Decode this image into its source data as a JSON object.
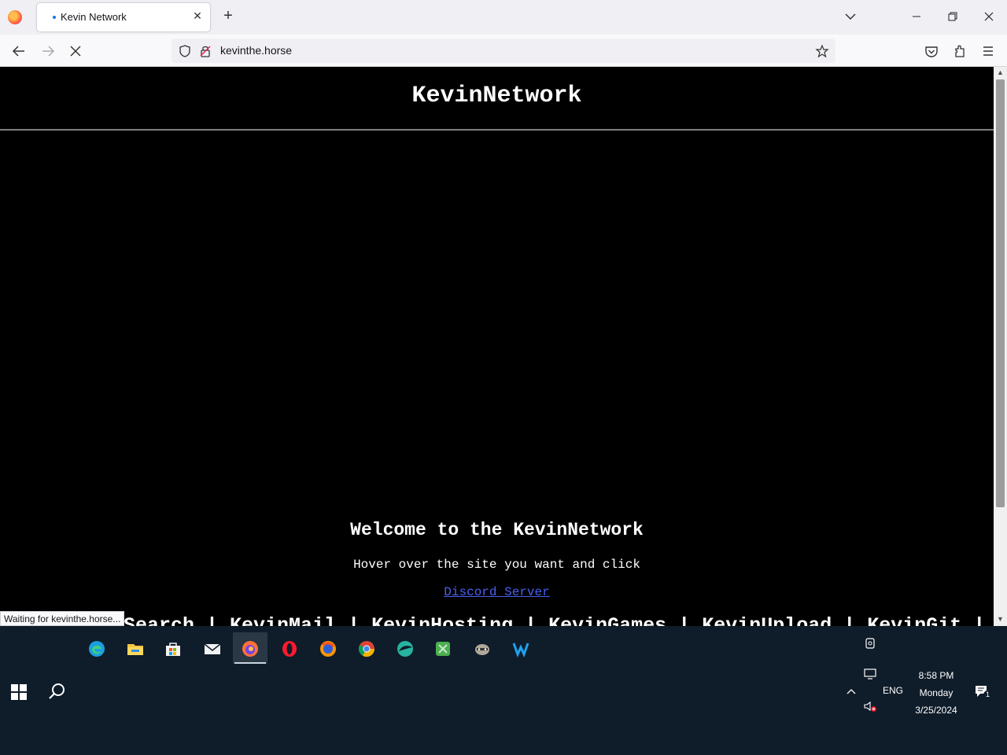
{
  "browser": {
    "tab_title": "Kevin Network",
    "url": "kevinthe.horse",
    "status_text": "Waiting for kevinthe.horse..."
  },
  "page": {
    "site_title": "KevinNetwork",
    "welcome_heading": "Welcome to the KevinNetwork",
    "instruction": "Hover over the site you want and click",
    "discord_link": "Discord Server",
    "links": [
      "Search",
      "|",
      "KevinMail",
      "|",
      "KevinHosting",
      "|",
      "KevinGames",
      "|",
      "KevinUpload",
      "|",
      "KevinGit",
      "|"
    ]
  },
  "taskbar": {
    "apps": [
      "edge-icon",
      "file-explorer-icon",
      "microsoft-store-icon",
      "mail-icon",
      "firefox-icon",
      "opera-icon",
      "firefox-icon",
      "chrome-icon",
      "browser-icon",
      "app-icon",
      "raccoon-app-icon",
      "waterfox-icon"
    ],
    "language": "ENG",
    "time": "8:58 PM",
    "day": "Monday",
    "date": "3/25/2024",
    "notification_count": "1"
  },
  "colors": {
    "page_bg": "#000000",
    "link": "#4a5ff0",
    "taskbar_bg": "#0f1c2a"
  }
}
